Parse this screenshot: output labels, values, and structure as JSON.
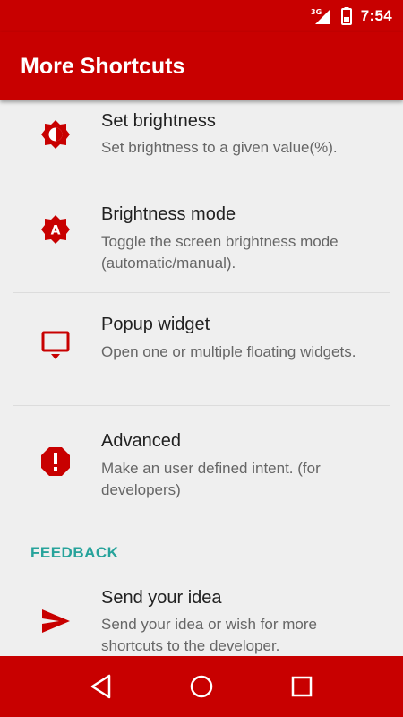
{
  "status_bar": {
    "time": "7:54",
    "network": "3G"
  },
  "app_bar": {
    "title": "More Shortcuts"
  },
  "items": [
    {
      "title": "Set brightness",
      "subtitle": "Set brightness to a given value(%).",
      "icon": "brightness-icon"
    },
    {
      "title": "Brightness mode",
      "subtitle": "Toggle the screen brightness mode (automatic/manual).",
      "icon": "brightness-auto-icon"
    },
    {
      "title": "Popup widget",
      "subtitle": "Open one or multiple floating widgets.",
      "icon": "popup-widget-icon"
    },
    {
      "title": "Advanced",
      "subtitle": "Make an user defined intent. (for developers)",
      "icon": "alert-octagon-icon"
    }
  ],
  "feedback_section": {
    "header": "FEEDBACK",
    "items": [
      {
        "title": "Send your idea",
        "subtitle": "Send your idea or wish for more shortcuts to the developer.",
        "icon": "send-icon"
      }
    ]
  },
  "nav_bar": {
    "buttons": [
      "back",
      "home",
      "recents"
    ]
  },
  "colors": {
    "primary": "#c80000",
    "accent": "#27a39b",
    "background": "#efefef"
  }
}
